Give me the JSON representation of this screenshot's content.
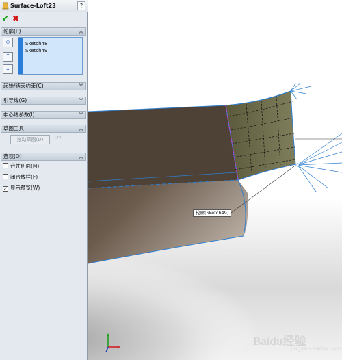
{
  "feature": {
    "title": "Surface-Loft23",
    "help": "?"
  },
  "actions": {
    "ok": "✔",
    "cancel": "✖"
  },
  "groups": {
    "profiles": {
      "label": "轮廓(P)",
      "items": [
        "Sketch48",
        "Sketch49"
      ]
    },
    "start_end": {
      "label": "起始/结束约束(C)"
    },
    "guides": {
      "label": "引导线(G)"
    },
    "centerline": {
      "label": "中心线参数(I)"
    },
    "sketch_tools": {
      "label": "草图工具",
      "drag_label": "拖动草图(D)"
    },
    "options": {
      "label": "选项(O)",
      "items": [
        {
          "label": "合并切面(M)",
          "checked": false
        },
        {
          "label": "闭合放样(F)",
          "checked": false
        },
        {
          "label": "显示预览(W)",
          "checked": true
        }
      ]
    }
  },
  "viewport": {
    "callout": "轮廓(Sketch49)",
    "watermark": "Baidu经验",
    "watermark_url": "jingyan.baidu.com"
  },
  "colors": {
    "accent": "#2b7ed8",
    "surface_dark": "#5a4a3c",
    "surface_olive": "#6b6a4a",
    "ok": "#12a312",
    "cancel": "#d21414"
  }
}
